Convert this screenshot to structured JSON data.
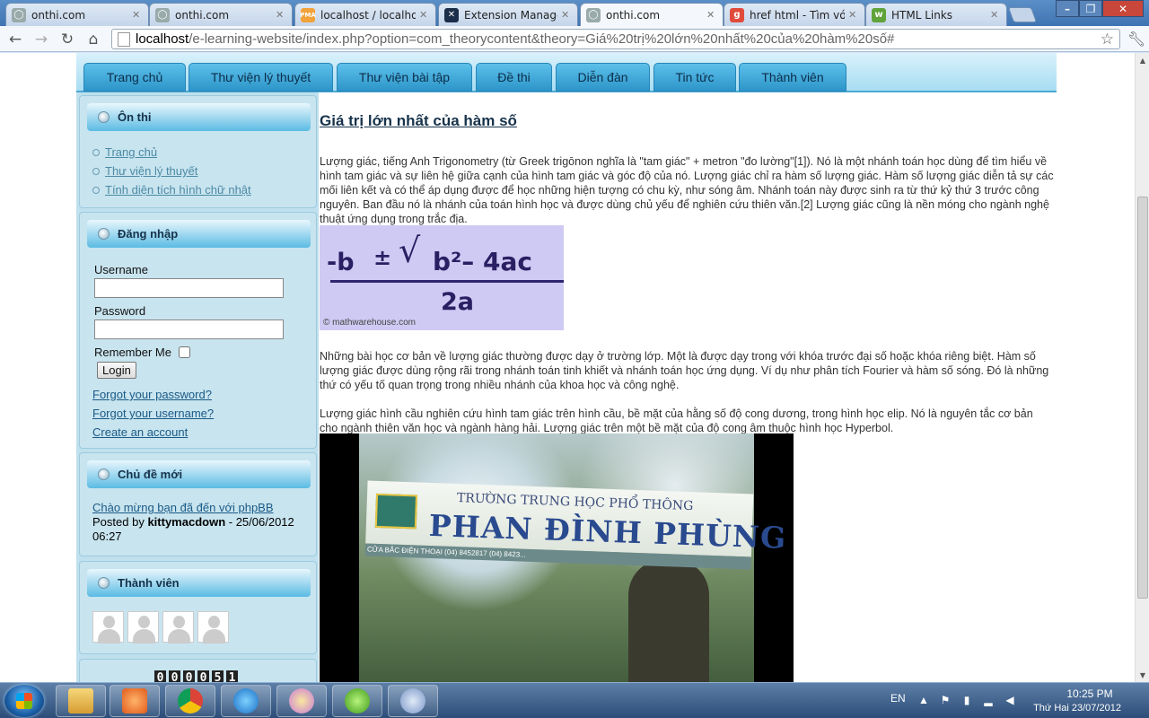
{
  "browser": {
    "tabs": [
      {
        "label": "onthi.com",
        "favicon": "globe-icon",
        "active": false
      },
      {
        "label": "onthi.com",
        "favicon": "globe-icon",
        "active": false
      },
      {
        "label": "localhost / localhost",
        "favicon": "phpmyadmin-icon",
        "active": false
      },
      {
        "label": "Extension Manager:",
        "favicon": "joomla-icon",
        "active": false
      },
      {
        "label": "onthi.com",
        "favicon": "globe-icon",
        "active": true
      },
      {
        "label": "href html - Tìm với G",
        "favicon": "google-icon",
        "active": false
      },
      {
        "label": "HTML Links",
        "favicon": "w3schools-icon",
        "active": false
      }
    ],
    "url_host": "localhost",
    "url_path": "/e-learning-website/index.php?option=com_theorycontent&theory=Giá%20trị%20lớn%20nhất%20của%20hàm%20số#"
  },
  "site": {
    "menu": [
      "Trang chủ",
      "Thư viện lý thuyết",
      "Thư viện bài tập",
      "Đề thi",
      "Diễn đàn",
      "Tin tức",
      "Thành viên"
    ],
    "modules": {
      "review": {
        "title": "Ôn thi",
        "links": [
          "Trang chủ",
          "Thư viện lý thuyết",
          "Tính diện tích hình chữ nhật"
        ]
      },
      "login": {
        "title": "Đăng nhập",
        "username_label": "Username",
        "password_label": "Password",
        "remember_label": "Remember Me",
        "login_button": "Login",
        "forgot_password": "Forgot your password?",
        "forgot_username": "Forgot your username?",
        "create_account": "Create an account"
      },
      "topics": {
        "title": "Chủ đề mới",
        "topic_link": "Chào mừng bạn đã đến với phpBB",
        "posted_by_label": "Posted by",
        "author": "kittymacdown",
        "date_part1": " - 25/06/2012",
        "date_part2": "06:27"
      },
      "members": {
        "title": "Thành viên",
        "avatar_count": 4
      },
      "counter": {
        "digits": [
          "0",
          "0",
          "0",
          "0",
          "5",
          "1"
        ]
      }
    },
    "article": {
      "title": "Giá trị lớn nhất của hàm số",
      "para1": "Lượng giác, tiếng Anh Trigonometry (từ Greek trigōnon nghĩa là \"tam giác\" + metron \"đo lường\"[1]). Nó là một nhánh toán học dùng để tìm hiểu về hình tam giác và sự liên hệ giữa cạnh của hình tam giác và góc độ của nó. Lượng giác chỉ ra hàm số lượng giác. Hàm số lượng giác diễn tả sự các mối liên kết và có thể áp dụng được để học những hiện tượng có chu kỳ, như sóng âm. Nhánh toán này được sinh ra từ thứ kỷ thứ 3 trước công nguyên. Ban đầu nó là nhánh của toán hình học và được dùng chủ yếu để nghiên cứu thiên văn.[2] Lượng giác cũng là nền móng cho ngành nghệ thuật ứng dụng trong trắc địa.",
      "formula": {
        "numerator_left": "-b",
        "plus_minus": "±",
        "radical": "√",
        "radicand": "b²– 4ac",
        "denominator": "2a",
        "credit": "© mathwarehouse.com"
      },
      "para2": "Những bài học cơ bản về lượng giác thường được dạy ở trường lớp. Một là được dạy trong với khóa trước đại số hoặc khóa riêng biệt. Hàm số lượng giác được dùng rộng rãi trong nhánh toán tinh khiết và nhánh toán học ứng dụng. Ví dụ như phân tích Fourier và hàm số sóng. Đó là những thứ có yếu tố quan trọng trong nhiều nhánh của khoa học và công nghệ.",
      "para3": "Lượng giác hình cầu nghiên cứu hình tam giác trên hình cầu, bề mặt của hằng số độ cong dương, trong hình học elip. Nó là nguyên tắc cơ bản cho ngành thiên văn học và ngành hàng hải. Lượng giác trên một bề mặt của độ cong âm thuộc hình học Hyperbol.",
      "photo": {
        "sign_line1": "TRƯỜNG TRUNG HỌC PHỔ THÔNG",
        "sign_line2": "PHAN ĐÌNH PHÙNG",
        "sign_line3": "CỬA BẮC                                   ĐIỆN THOẠI (04) 8452817 (04) 8423...",
        "sign_left": "CỬA BẮC"
      }
    }
  },
  "taskbar": {
    "apps": [
      "explorer-icon",
      "media-player-icon",
      "chrome-icon",
      "internet-explorer-icon",
      "paint-icon",
      "dreamweaver-icon",
      "network-icon"
    ],
    "language": "EN",
    "time": "10:25 PM",
    "date": "Thứ Hai 23/07/2012"
  },
  "colors": {
    "menu_tab": "#2d95c9",
    "sidebar_bg": "#bfe0ec",
    "title_text": "#16324a",
    "link_text": "#1a5a86"
  }
}
